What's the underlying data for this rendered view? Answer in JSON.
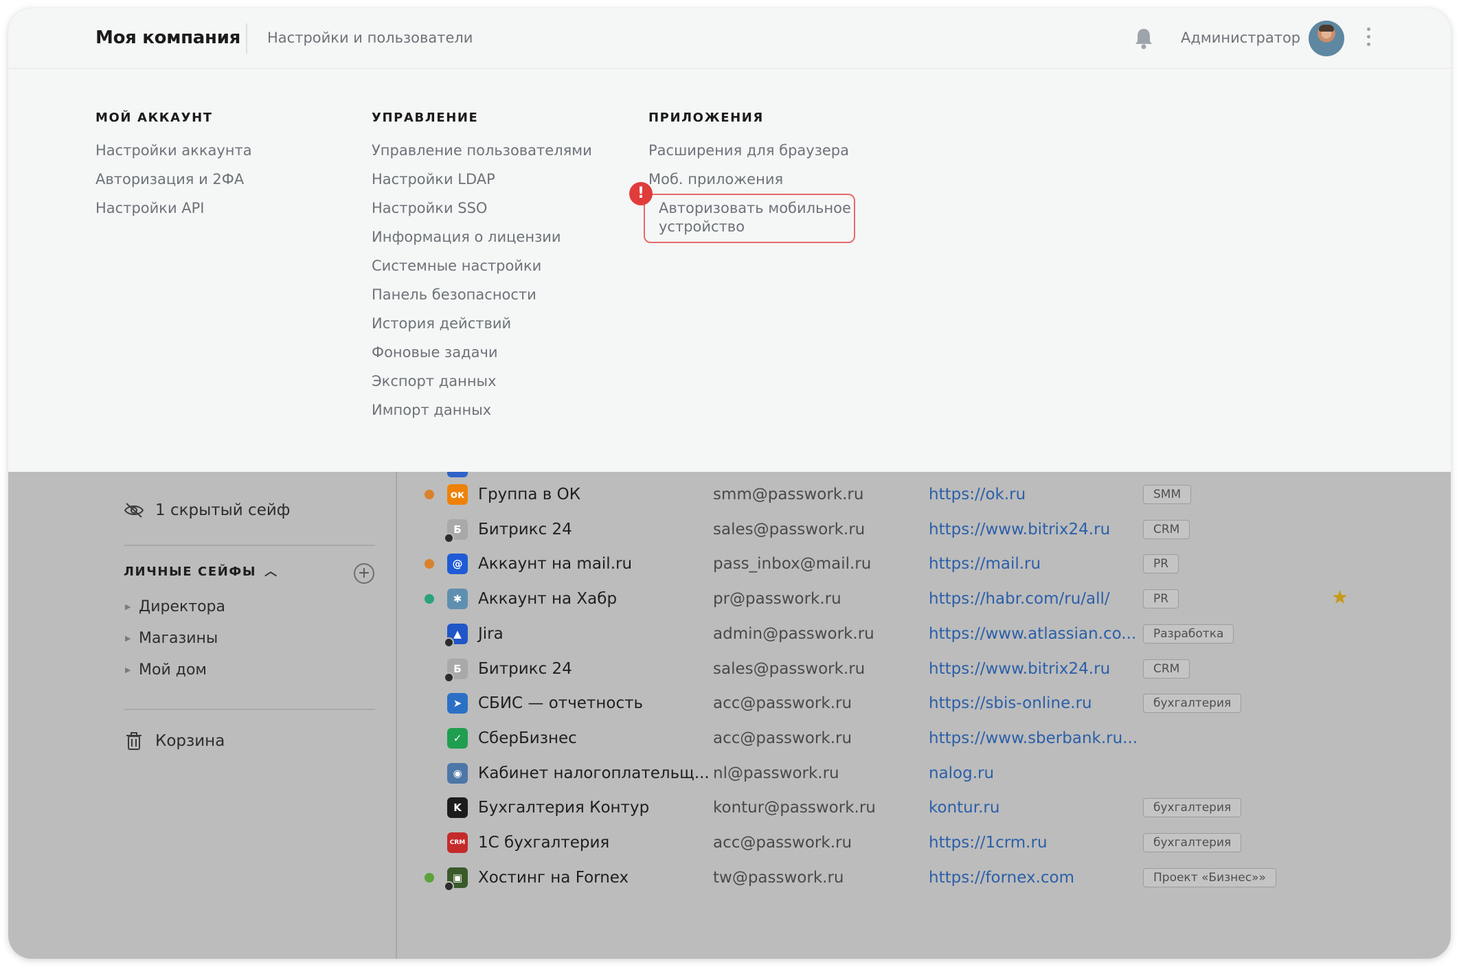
{
  "header": {
    "company": "Моя компания",
    "section": "Настройки и пользователи",
    "user_name": "Администратор",
    "icons": [
      "bell-icon",
      "avatar",
      "kebab-menu-icon"
    ]
  },
  "menu": {
    "account": {
      "title": "МОЙ АККАУНТ",
      "items": [
        "Настройки аккаунта",
        "Авторизация и 2ФА",
        "Настройки API"
      ]
    },
    "management": {
      "title": "УПРАВЛЕНИЕ",
      "items": [
        "Управление пользователями",
        "Настройки LDAP",
        "Настройки SSO",
        "Информация о лицензии",
        "Системные настройки",
        "Панель безопасности",
        "История действий",
        "Фоновые задачи",
        "Экспорт данных",
        "Импорт данных"
      ]
    },
    "apps": {
      "title": "ПРИЛОЖЕНИЯ",
      "items": [
        "Расширения для браузера",
        "Моб. приложения"
      ],
      "highlighted_item": "Авторизовать мобильное устройство",
      "alert_mark": "!"
    }
  },
  "sidebar": {
    "hidden_safes": "1 скрытый сейф",
    "personal_title": "ЛИЧНЫЕ СЕЙФЫ",
    "folders": [
      "Директора",
      "Магазины",
      "Мой дом"
    ],
    "trash": "Корзина"
  },
  "passwords": [
    {
      "name": "Группа в ОК",
      "login": "smm@passwork.ru",
      "url": "https://ok.ru",
      "tag": "SMM",
      "dot": "#d9822b",
      "icon": "ok-icon",
      "icon_color": "#ee8208",
      "icon_glyph": "ок",
      "shared": false,
      "star": false
    },
    {
      "name": "Битрикс 24",
      "login": "sales@passwork.ru",
      "url": "https://www.bitrix24.ru",
      "tag": "CRM",
      "dot": "",
      "icon": "bitrix-icon",
      "icon_color": "#a9a9a9",
      "icon_glyph": "Б",
      "shared": true,
      "star": false
    },
    {
      "name": "Аккаунт на mail.ru",
      "login": "pass_inbox@mail.ru",
      "url": "https://mail.ru",
      "tag": "PR",
      "dot": "#d9822b",
      "icon": "mailru-icon",
      "icon_color": "#1f5bd6",
      "icon_glyph": "@",
      "shared": false,
      "star": false
    },
    {
      "name": "Аккаунт на Хабр",
      "login": "pr@passwork.ru",
      "url": "https://habr.com/ru/all/",
      "tag": "PR",
      "dot": "#2aa37a",
      "icon": "habr-icon",
      "icon_color": "#5f8fb0",
      "icon_glyph": "✱",
      "shared": false,
      "star": true
    },
    {
      "name": "Jira",
      "login": "admin@passwork.ru",
      "url": "https://www.atlassian.co...",
      "tag": "Разработка",
      "dot": "",
      "icon": "jira-icon",
      "icon_color": "#2056c7",
      "icon_glyph": "▲",
      "shared": true,
      "star": false
    },
    {
      "name": "Битрикс 24",
      "login": "sales@passwork.ru",
      "url": "https://www.bitrix24.ru",
      "tag": "CRM",
      "dot": "",
      "icon": "bitrix-icon",
      "icon_color": "#a9a9a9",
      "icon_glyph": "Б",
      "shared": true,
      "star": false
    },
    {
      "name": "СБИС — отчетность",
      "login": "acc@passwork.ru",
      "url": "https://sbis-online.ru",
      "tag": "бухгалтерия",
      "dot": "",
      "icon": "sbis-icon",
      "icon_color": "#2c70c6",
      "icon_glyph": "➤",
      "shared": false,
      "star": false
    },
    {
      "name": "СберБизнес",
      "login": "acc@passwork.ru",
      "url": "https://www.sberbank.ru...",
      "tag": "",
      "dot": "",
      "icon": "sber-icon",
      "icon_color": "#1f9e4f",
      "icon_glyph": "✓",
      "shared": false,
      "star": false
    },
    {
      "name": "Кабинет налогоплательщ...",
      "login": "nl@passwork.ru",
      "url": "nalog.ru",
      "tag": "",
      "dot": "",
      "icon": "nalog-icon",
      "icon_color": "#4d77a8",
      "icon_glyph": "◉",
      "shared": false,
      "star": false
    },
    {
      "name": "Бухгалтерия Контур",
      "login": "kontur@passwork.ru",
      "url": "kontur.ru",
      "tag": "бухгалтерия",
      "dot": "",
      "icon": "kontur-icon",
      "icon_color": "#1c1c1c",
      "icon_glyph": "K",
      "shared": false,
      "star": false
    },
    {
      "name": "1С бухгалтерия",
      "login": "acc@passwork.ru",
      "url": "https://1crm.ru",
      "tag": "бухгалтерия",
      "dot": "",
      "icon": "1crm-icon",
      "icon_color": "#c52a2a",
      "icon_glyph": "CRM",
      "shared": false,
      "star": false
    },
    {
      "name": "Хостинг на Fornex",
      "login": "tw@passwork.ru",
      "url": "https://fornex.com",
      "tag": "Проект «Бизнес»»",
      "dot": "#5aa33a",
      "icon": "fornex-icon",
      "icon_color": "#3a5a2a",
      "icon_glyph": "▣",
      "shared": true,
      "star": false
    }
  ],
  "colors": {
    "accent_link": "#2b5fa8",
    "alert": "#e03c3c",
    "highlight_border": "#e66a6a",
    "star": "#c79a15"
  }
}
